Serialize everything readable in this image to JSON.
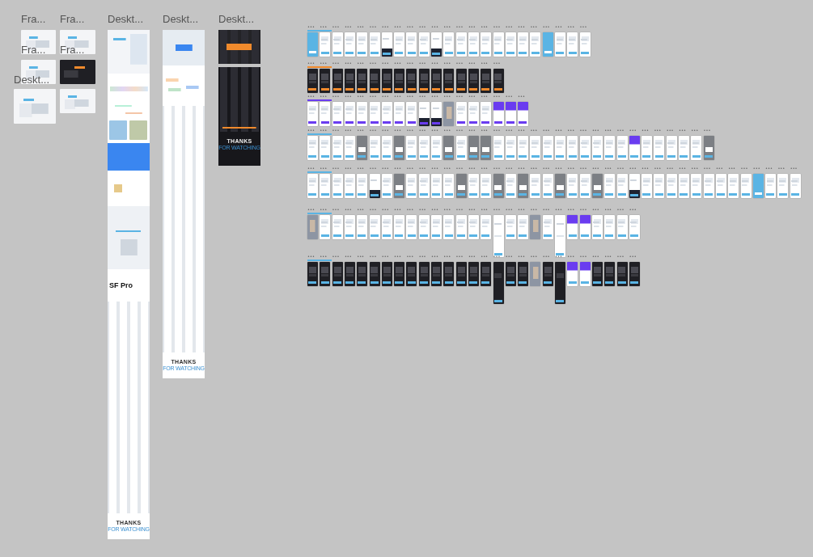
{
  "left_frames": [
    {
      "label": "Fra...",
      "kind": "light"
    },
    {
      "label": "Fra...",
      "kind": "light"
    },
    {
      "label": "Fra...",
      "kind": "light"
    },
    {
      "label": "Fra...",
      "kind": "dark"
    },
    {
      "label": "Deskt...",
      "kind": "light"
    },
    {
      "kind": "light"
    }
  ],
  "desktops": [
    {
      "label": "Deskt...",
      "kind": "long",
      "texts": [
        "SF Pro",
        "THANKS",
        "FOR WATCHING"
      ]
    },
    {
      "label": "Deskt...",
      "kind": "medium",
      "texts": [
        "THANKS",
        "FOR WATCHING"
      ]
    },
    {
      "label": "Deskt...",
      "kind": "dark",
      "texts": [
        "THANKS",
        "FOR WATCHING"
      ]
    }
  ],
  "rows": [
    {
      "color": "#5ab4e4",
      "frames": [
        {
          "label": "•••",
          "kind": "blue"
        },
        {
          "label": "•••",
          "kind": "light"
        },
        {
          "label": "•••",
          "kind": "light"
        },
        {
          "label": "•••",
          "kind": "light"
        },
        {
          "label": "•••",
          "kind": "light"
        },
        {
          "label": "•••",
          "kind": "light"
        },
        {
          "label": "•••",
          "kind": "lightdark"
        },
        {
          "label": "•••",
          "kind": "light"
        },
        {
          "label": "•••",
          "kind": "light"
        },
        {
          "label": "•••",
          "kind": "light"
        },
        {
          "label": "•••",
          "kind": "lightdark"
        },
        {
          "label": "•••",
          "kind": "light"
        },
        {
          "label": "•••",
          "kind": "light"
        },
        {
          "label": "•••",
          "kind": "light"
        },
        {
          "label": "•••",
          "kind": "light"
        },
        {
          "label": "•••",
          "kind": "light"
        },
        {
          "label": "•••",
          "kind": "light"
        },
        {
          "label": "•••",
          "kind": "light"
        },
        {
          "label": "•••",
          "kind": "light"
        },
        {
          "label": "•••",
          "kind": "blue"
        },
        {
          "label": "•••",
          "kind": "light"
        },
        {
          "label": "•••",
          "kind": "light"
        },
        {
          "label": "•••",
          "kind": "light"
        }
      ]
    },
    {
      "color": "#f08a2c",
      "frames": [
        {
          "label": "•••",
          "kind": "dark"
        },
        {
          "label": "•••",
          "kind": "dark"
        },
        {
          "label": "•••",
          "kind": "dark"
        },
        {
          "label": "•••",
          "kind": "dark"
        },
        {
          "label": "•••",
          "kind": "dark"
        },
        {
          "label": "•••",
          "kind": "dark"
        },
        {
          "label": "•••",
          "kind": "dark"
        },
        {
          "label": "•••",
          "kind": "dark"
        },
        {
          "label": "•••",
          "kind": "dark"
        },
        {
          "label": "•••",
          "kind": "dark"
        },
        {
          "label": "•••",
          "kind": "dark"
        },
        {
          "label": "•••",
          "kind": "dark"
        },
        {
          "label": "•••",
          "kind": "dark"
        },
        {
          "label": "•••",
          "kind": "dark"
        },
        {
          "label": "•••",
          "kind": "dark"
        },
        {
          "label": "•••",
          "kind": "dark"
        }
      ]
    },
    {
      "color": "#6a3cf0",
      "frames": [
        {
          "label": "•••",
          "kind": "light"
        },
        {
          "label": "•••",
          "kind": "light"
        },
        {
          "label": "•••",
          "kind": "light"
        },
        {
          "label": "•••",
          "kind": "light"
        },
        {
          "label": "•••",
          "kind": "light"
        },
        {
          "label": "•••",
          "kind": "light"
        },
        {
          "label": "•••",
          "kind": "light"
        },
        {
          "label": "•••",
          "kind": "light"
        },
        {
          "label": "•••",
          "kind": "light"
        },
        {
          "label": "•••",
          "kind": "lightdark"
        },
        {
          "label": "•••",
          "kind": "lightdark"
        },
        {
          "label": "•••",
          "kind": "photo"
        },
        {
          "label": "•••",
          "kind": "light"
        },
        {
          "label": "•••",
          "kind": "light"
        },
        {
          "label": "•••",
          "kind": "light"
        },
        {
          "label": "•••",
          "kind": "purple"
        },
        {
          "label": "•••",
          "kind": "purple"
        },
        {
          "label": "•••",
          "kind": "purple"
        }
      ]
    },
    {
      "color": "#5ab4e4",
      "frames": [
        {
          "label": "•••",
          "kind": "light"
        },
        {
          "label": "•••",
          "kind": "light"
        },
        {
          "label": "•••",
          "kind": "light"
        },
        {
          "label": "•••",
          "kind": "light"
        },
        {
          "label": "•••",
          "kind": "gray"
        },
        {
          "label": "•••",
          "kind": "light"
        },
        {
          "label": "•••",
          "kind": "light"
        },
        {
          "label": "•••",
          "kind": "gray"
        },
        {
          "label": "•••",
          "kind": "light"
        },
        {
          "label": "•••",
          "kind": "light"
        },
        {
          "label": "•••",
          "kind": "light"
        },
        {
          "label": "•••",
          "kind": "gray"
        },
        {
          "label": "•••",
          "kind": "light"
        },
        {
          "label": "•••",
          "kind": "gray"
        },
        {
          "label": "•••",
          "kind": "gray"
        },
        {
          "label": "•••",
          "kind": "light"
        },
        {
          "label": "•••",
          "kind": "light"
        },
        {
          "label": "•••",
          "kind": "light"
        },
        {
          "label": "•••",
          "kind": "light"
        },
        {
          "label": "•••",
          "kind": "light"
        },
        {
          "label": "•••",
          "kind": "light"
        },
        {
          "label": "•••",
          "kind": "light"
        },
        {
          "label": "•••",
          "kind": "light"
        },
        {
          "label": "•••",
          "kind": "light"
        },
        {
          "label": "•••",
          "kind": "light"
        },
        {
          "label": "•••",
          "kind": "light"
        },
        {
          "label": "•••",
          "kind": "purple"
        },
        {
          "label": "•••",
          "kind": "light"
        },
        {
          "label": "•••",
          "kind": "light"
        },
        {
          "label": "•••",
          "kind": "light"
        },
        {
          "label": "•••",
          "kind": "light"
        },
        {
          "label": "•••",
          "kind": "light"
        },
        {
          "label": "•••",
          "kind": "gray"
        }
      ]
    },
    {
      "color": "#5ab4e4",
      "frames": [
        {
          "label": "•••",
          "kind": "light"
        },
        {
          "label": "•••",
          "kind": "light"
        },
        {
          "label": "•••",
          "kind": "light"
        },
        {
          "label": "•••",
          "kind": "light"
        },
        {
          "label": "•••",
          "kind": "light"
        },
        {
          "label": "•••",
          "kind": "lightdark"
        },
        {
          "label": "•••",
          "kind": "light"
        },
        {
          "label": "•••",
          "kind": "gray"
        },
        {
          "label": "•••",
          "kind": "light"
        },
        {
          "label": "•••",
          "kind": "light"
        },
        {
          "label": "•••",
          "kind": "light"
        },
        {
          "label": "•••",
          "kind": "light"
        },
        {
          "label": "•••",
          "kind": "gray"
        },
        {
          "label": "•••",
          "kind": "light"
        },
        {
          "label": "•••",
          "kind": "light"
        },
        {
          "label": "•••",
          "kind": "gray"
        },
        {
          "label": "•••",
          "kind": "light"
        },
        {
          "label": "•••",
          "kind": "gray"
        },
        {
          "label": "•••",
          "kind": "light"
        },
        {
          "label": "•••",
          "kind": "light"
        },
        {
          "label": "•••",
          "kind": "gray"
        },
        {
          "label": "•••",
          "kind": "light"
        },
        {
          "label": "•••",
          "kind": "light"
        },
        {
          "label": "•••",
          "kind": "gray"
        },
        {
          "label": "•••",
          "kind": "light"
        },
        {
          "label": "•••",
          "kind": "light"
        },
        {
          "label": "•••",
          "kind": "lightdark"
        },
        {
          "label": "•••",
          "kind": "light"
        },
        {
          "label": "•••",
          "kind": "light"
        },
        {
          "label": "•••",
          "kind": "light"
        },
        {
          "label": "•••",
          "kind": "light"
        },
        {
          "label": "•••",
          "kind": "light"
        },
        {
          "label": "•••",
          "kind": "light"
        },
        {
          "label": "•••",
          "kind": "light"
        },
        {
          "label": "•••",
          "kind": "light"
        },
        {
          "label": "•••",
          "kind": "light"
        },
        {
          "label": "•••",
          "kind": "blue"
        },
        {
          "label": "•••",
          "kind": "light"
        },
        {
          "label": "•••",
          "kind": "light"
        },
        {
          "label": "•••",
          "kind": "light"
        }
      ]
    },
    {
      "color": "#5ab4e4",
      "frames": [
        {
          "label": "•••",
          "kind": "photo"
        },
        {
          "label": "•••",
          "kind": "light"
        },
        {
          "label": "•••",
          "kind": "light"
        },
        {
          "label": "•••",
          "kind": "light"
        },
        {
          "label": "•••",
          "kind": "light"
        },
        {
          "label": "•••",
          "kind": "light"
        },
        {
          "label": "•••",
          "kind": "light"
        },
        {
          "label": "•••",
          "kind": "light"
        },
        {
          "label": "•••",
          "kind": "light"
        },
        {
          "label": "•••",
          "kind": "light"
        },
        {
          "label": "•••",
          "kind": "light"
        },
        {
          "label": "•••",
          "kind": "light"
        },
        {
          "label": "•••",
          "kind": "light"
        },
        {
          "label": "•••",
          "kind": "light"
        },
        {
          "label": "•••",
          "kind": "light"
        },
        {
          "label": "•••",
          "kind": "tall"
        },
        {
          "label": "•••",
          "kind": "light"
        },
        {
          "label": "•••",
          "kind": "light"
        },
        {
          "label": "•••",
          "kind": "photo"
        },
        {
          "label": "•••",
          "kind": "light"
        },
        {
          "label": "•••",
          "kind": "tall"
        },
        {
          "label": "•••",
          "kind": "purple"
        },
        {
          "label": "•••",
          "kind": "purple"
        },
        {
          "label": "•••",
          "kind": "light"
        },
        {
          "label": "•••",
          "kind": "light"
        },
        {
          "label": "•••",
          "kind": "light"
        },
        {
          "label": "•••",
          "kind": "light"
        }
      ]
    },
    {
      "color": "#5ab4e4",
      "frames": [
        {
          "label": "•••",
          "kind": "dark"
        },
        {
          "label": "•••",
          "kind": "dark"
        },
        {
          "label": "•••",
          "kind": "dark"
        },
        {
          "label": "•••",
          "kind": "dark"
        },
        {
          "label": "•••",
          "kind": "dark"
        },
        {
          "label": "•••",
          "kind": "dark"
        },
        {
          "label": "•••",
          "kind": "dark"
        },
        {
          "label": "•••",
          "kind": "dark"
        },
        {
          "label": "•••",
          "kind": "dark"
        },
        {
          "label": "•••",
          "kind": "dark"
        },
        {
          "label": "•••",
          "kind": "dark"
        },
        {
          "label": "•••",
          "kind": "dark"
        },
        {
          "label": "•••",
          "kind": "dark"
        },
        {
          "label": "•••",
          "kind": "dark"
        },
        {
          "label": "•••",
          "kind": "dark"
        },
        {
          "label": "•••",
          "kind": "talldark"
        },
        {
          "label": "•••",
          "kind": "dark"
        },
        {
          "label": "•••",
          "kind": "dark"
        },
        {
          "label": "•••",
          "kind": "photo"
        },
        {
          "label": "•••",
          "kind": "dark"
        },
        {
          "label": "•••",
          "kind": "talldark"
        },
        {
          "label": "•••",
          "kind": "purple"
        },
        {
          "label": "•••",
          "kind": "purple"
        },
        {
          "label": "•••",
          "kind": "dark"
        },
        {
          "label": "•••",
          "kind": "dark"
        },
        {
          "label": "•••",
          "kind": "dark"
        },
        {
          "label": "•••",
          "kind": "dark"
        }
      ]
    }
  ]
}
